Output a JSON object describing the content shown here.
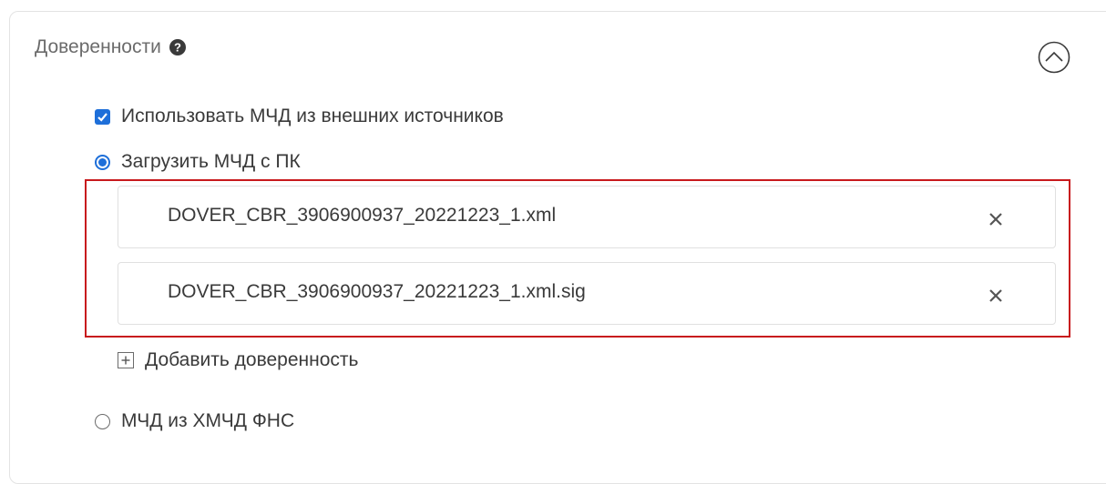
{
  "section": {
    "title": "Доверенности",
    "help_icon": "question-circle-icon",
    "collapse_icon": "chevron-up-circle-icon"
  },
  "options": {
    "use_external_label": "Использовать МЧД из внешних источников",
    "use_external_checked": true,
    "upload_from_pc_label": "Загрузить МЧД с ПК",
    "upload_from_pc_selected": true,
    "from_fns_label": "МЧД из ХМЧД ФНС",
    "from_fns_selected": false
  },
  "files": [
    {
      "name": "DOVER_CBR_3906900937_20221223_1.xml",
      "remove_icon": "close-icon"
    },
    {
      "name": "DOVER_CBR_3906900937_20221223_1.xml.sig",
      "remove_icon": "close-icon"
    }
  ],
  "add_proxy": {
    "label": "Добавить доверенность",
    "icon": "plus-square-icon"
  },
  "colors": {
    "accent": "#1e6fd9",
    "highlight": "#c8191d",
    "text": "#3a3a3a",
    "muted": "#6b6b6b"
  }
}
